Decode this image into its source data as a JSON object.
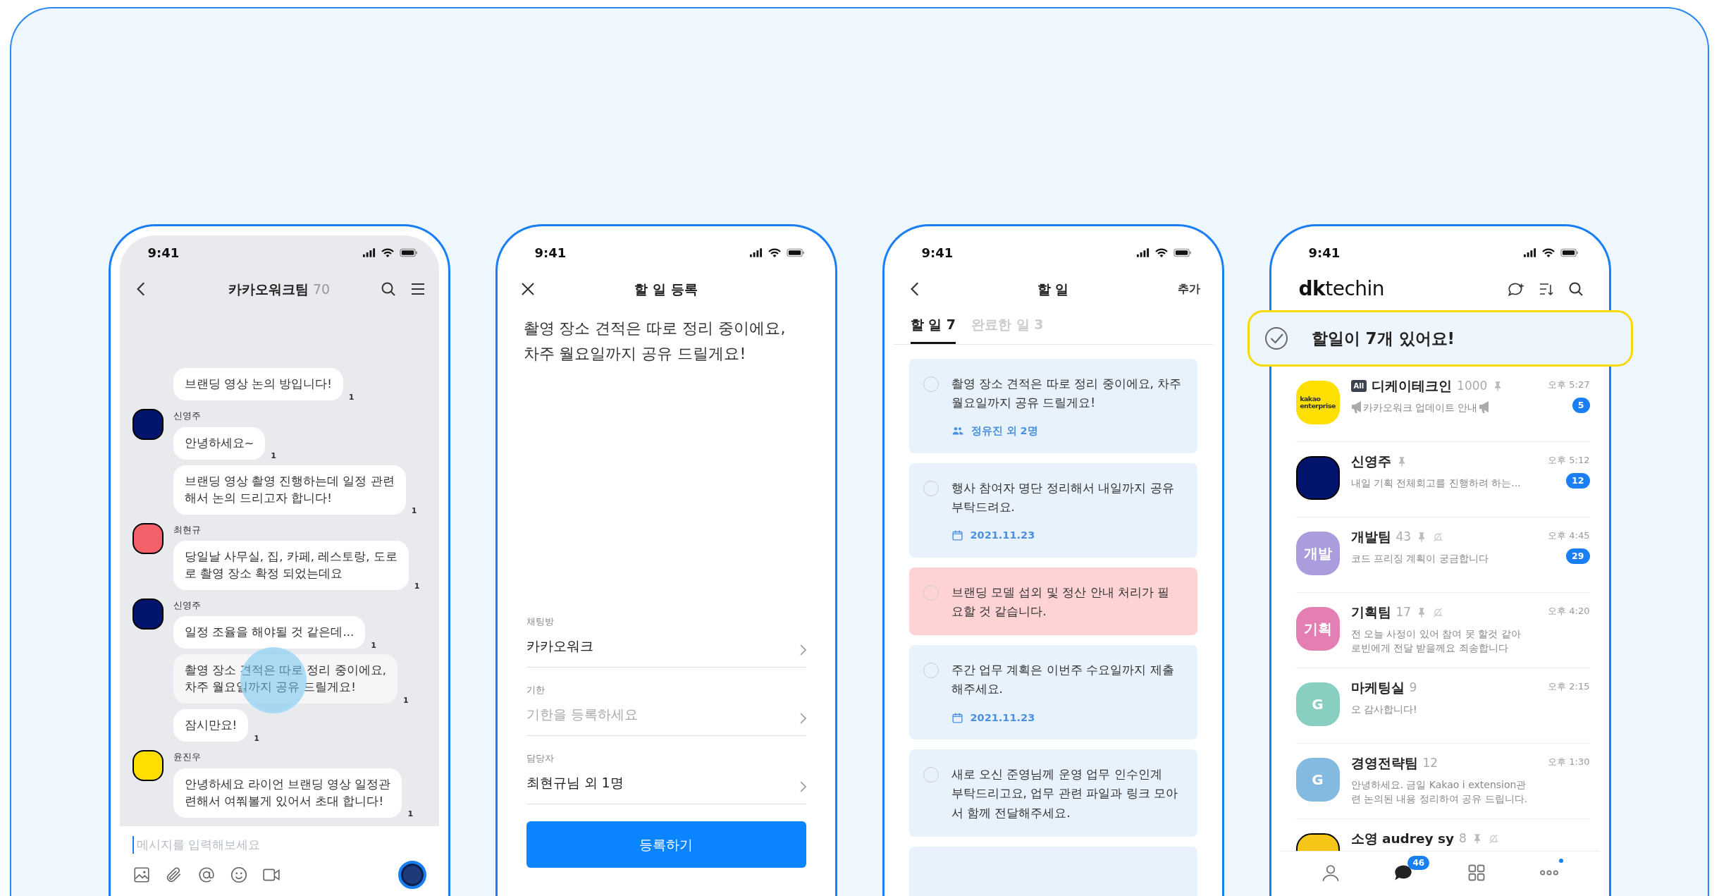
{
  "phones": [
    {
      "kind": "chat",
      "time": "9:41",
      "title": "카카오워크팀",
      "count": "70",
      "groups": [
        {
          "messages": [
            {
              "text": "브랜딩 영상 논의 방입니다!",
              "unread": "1",
              "pressed": false
            }
          ]
        },
        {
          "sender": "신영주",
          "color": "#02146b",
          "messages": [
            {
              "text": "안녕하세요~",
              "unread": "1",
              "pressed": false
            },
            {
              "text": "브랜딩 영상 촬영 진행하는데 일정 관련\n해서 논의 드리고자 합니다!",
              "unread": "1",
              "pressed": false
            }
          ]
        },
        {
          "sender": "최현규",
          "color": "#f4606a",
          "messages": [
            {
              "text": "당일날 사무실, 집, 카페, 레스토랑, 도로\n로 촬영 장소 확정 되었는데요",
              "unread": "1",
              "pressed": false
            }
          ]
        },
        {
          "sender": "신영주",
          "color": "#02146b",
          "messages": [
            {
              "text": "일정 조율을 해야될 것 같은데...",
              "unread": "1",
              "pressed": false
            },
            {
              "text": "촬영 장소 견적은 따로 정리 중이에요,\n차주 월요일까지 공유 드릴게요!",
              "unread": "1",
              "pressed": true
            },
            {
              "text": "잠시만요!",
              "unread": "1",
              "pressed": false
            }
          ]
        },
        {
          "sender": "윤진우",
          "color": "#ffde00",
          "messages": [
            {
              "text": "안녕하세요 라이언 브랜딩 영상 일정관\n련해서 여쭤볼게 있어서 초대 합니다!",
              "unread": "1",
              "pressed": false
            }
          ]
        }
      ],
      "input": {
        "placeholder": "메시지를 입력해보세요"
      }
    },
    {
      "kind": "form",
      "time": "9:41",
      "title": "할 일 등록",
      "body": "촬영 장소 견적은 따로 정리 중이에요,\n차주 월요일까지 공유 드릴게요!",
      "fields": [
        {
          "label": "채팅방",
          "value": "카카오워크"
        },
        {
          "label": "기한",
          "placeholder": "기한을 등록하세요"
        },
        {
          "label": "담당자",
          "value": "최현규님 외 1명"
        }
      ],
      "button": "등록하기"
    },
    {
      "kind": "tasks",
      "time": "9:41",
      "title": "할 일",
      "action": "추가",
      "tabs": [
        {
          "label": "할 일 7",
          "selected": true
        },
        {
          "label": "완료한 일 3",
          "selected": false
        }
      ],
      "tasks": [
        {
          "text": "촬영 장소 견적은 따로 정리 중이에요, 차주\n월요일까지 공유 드릴게요!",
          "checked": false,
          "urgent": false,
          "meta": {
            "kind": "people",
            "text": "정유진 외 2명"
          }
        },
        {
          "text": "행사 참여자 명단 정리해서 내일까지 공유\n부탁드려요.",
          "checked": false,
          "urgent": false,
          "meta": {
            "kind": "date",
            "text": "2021.11.23"
          }
        },
        {
          "text": "브랜딩 모델 섭외 및 정산 안내 처리가 필\n요할 것 같습니다.",
          "checked": false,
          "urgent": true
        },
        {
          "text": "주간 업무 계획은 이번주 수요일까지 제출\n해주세요.",
          "checked": false,
          "urgent": false,
          "meta": {
            "kind": "date",
            "text": "2021.11.23"
          }
        },
        {
          "text": "새로 오신 준영님께 운영 업무 인수인계\n부탁드리고요, 업무 관련 파일과 링크 모아\n서 함께 전달해주세요.",
          "checked": false,
          "urgent": false
        }
      ]
    },
    {
      "kind": "list",
      "time": "9:41",
      "logo": "**dk**techin",
      "banner": "할일이 7개 있어요!",
      "chats": [
        {
          "avatar": {
            "kind": "logo",
            "color": "#fde000",
            "text": "kakao\nenterprise"
          },
          "tag": "All",
          "name": "디케이테크인",
          "count": "1000",
          "pinned": true,
          "muted": false,
          "announcement": true,
          "preview": "카카오워크 업데이트 안내",
          "time": "오후 5:27",
          "unread": "5"
        },
        {
          "avatar": {
            "kind": "plain",
            "color": "#02146b"
          },
          "name": "신영주",
          "pinned": true,
          "muted": false,
          "announcement": false,
          "preview": "내일 기획 전체회고를 진행하려 하는...",
          "time": "오후 5:12",
          "unread": "12"
        },
        {
          "avatar": {
            "kind": "initials",
            "color": "#ab9ddd",
            "text": "개발"
          },
          "name": "개발팀",
          "count": "43",
          "pinned": true,
          "muted": true,
          "announcement": false,
          "preview": "코드 프리징 계획이 궁금합니다",
          "time": "오후 4:45",
          "unread": "29"
        },
        {
          "avatar": {
            "kind": "initials",
            "color": "#e47fb4",
            "text": "기획"
          },
          "name": "기획팀",
          "count": "17",
          "pinned": true,
          "muted": true,
          "announcement": false,
          "preview": "전 오늘 사정이 있어 참여 못 할것 같아\n로빈에게 전달 받을께요 죄송합니다",
          "time": "오후 4:20"
        },
        {
          "avatar": {
            "kind": "initials",
            "color": "#88cfc1",
            "text": "G"
          },
          "name": "마케팅실",
          "count": "9",
          "pinned": false,
          "muted": false,
          "announcement": false,
          "preview": "오 감사합니다!",
          "time": "오후 2:15"
        },
        {
          "avatar": {
            "kind": "initials",
            "color": "#84badf",
            "text": "G"
          },
          "name": "경영전략팀",
          "count": "12",
          "pinned": false,
          "muted": false,
          "announcement": false,
          "preview": "안녕하세요. 금일 Kakao i extension관\n련 논의된 내용 정리하여 공유 드립니다.",
          "time": "오후 1:30"
        },
        {
          "avatar": {
            "kind": "plain",
            "color": "#f5c518"
          },
          "name": "소영 audrey sy",
          "count": "8",
          "pinned": true,
          "muted": true
        }
      ],
      "tabbar": [
        {
          "kind": "person",
          "selected": false
        },
        {
          "kind": "chat",
          "selected": true,
          "badge": "46"
        },
        {
          "kind": "grid",
          "selected": false
        },
        {
          "kind": "more",
          "selected": false,
          "dot": true
        }
      ]
    }
  ]
}
